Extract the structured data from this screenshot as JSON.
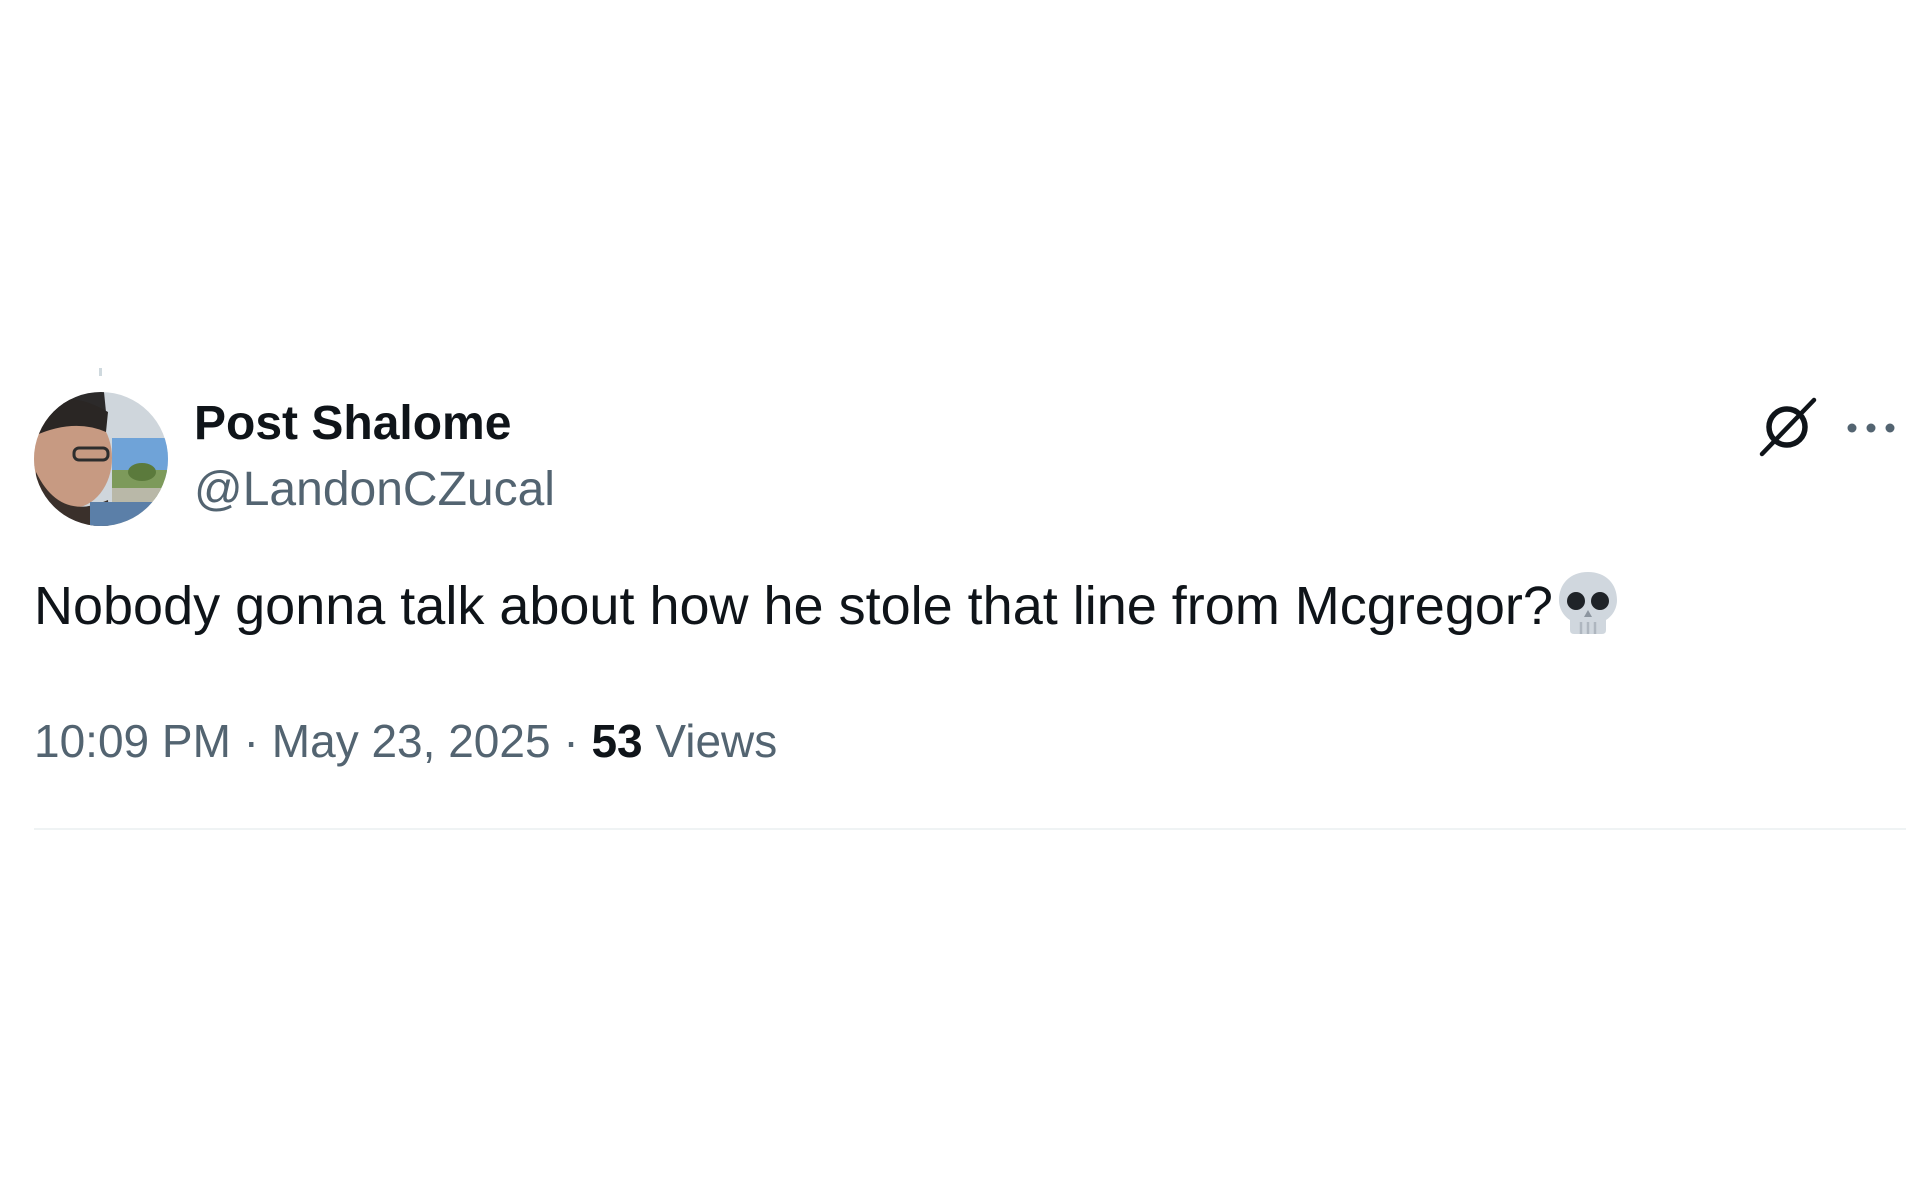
{
  "author": {
    "display_name": "Post Shalome",
    "handle": "@LandonCZucal",
    "avatar_icon": "profile-photo"
  },
  "actions": {
    "grok_icon": "grok-icon",
    "more_icon": "more-options-icon"
  },
  "post": {
    "text": "Nobody gonna talk about how he stole that line from Mcgregor?",
    "emoji": "skull"
  },
  "meta": {
    "time": "10:09 PM",
    "separator_1": " · ",
    "date": "May 23, 2025",
    "separator_2": " · ",
    "views_count": "53",
    "views_label": " Views"
  },
  "colors": {
    "primary_text": "#0f1419",
    "secondary_text": "#536471",
    "divider": "#eff3f4"
  }
}
